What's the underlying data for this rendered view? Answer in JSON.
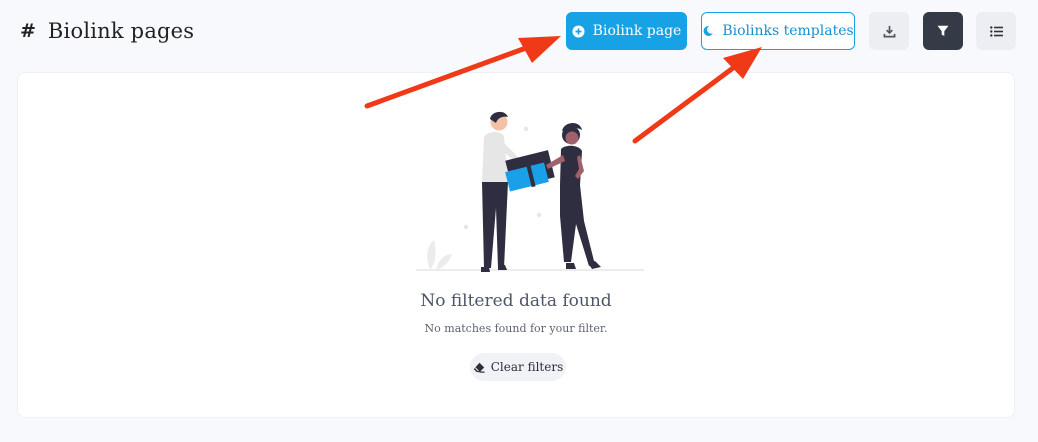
{
  "header": {
    "hash": "#",
    "title": "Biolink pages"
  },
  "toolbar": {
    "create_label": "Biolink page",
    "templates_label": "Biolinks templates",
    "download_icon": "download-icon",
    "filter_icon": "filter-icon",
    "list_icon": "list-icon"
  },
  "empty_state": {
    "title": "No filtered data found",
    "subtitle": "No matches found for your filter.",
    "clear_label": "Clear filters"
  },
  "colors": {
    "primary": "#17a2e6",
    "dark_button": "#343a46",
    "annotation_arrow": "#f03a17"
  }
}
